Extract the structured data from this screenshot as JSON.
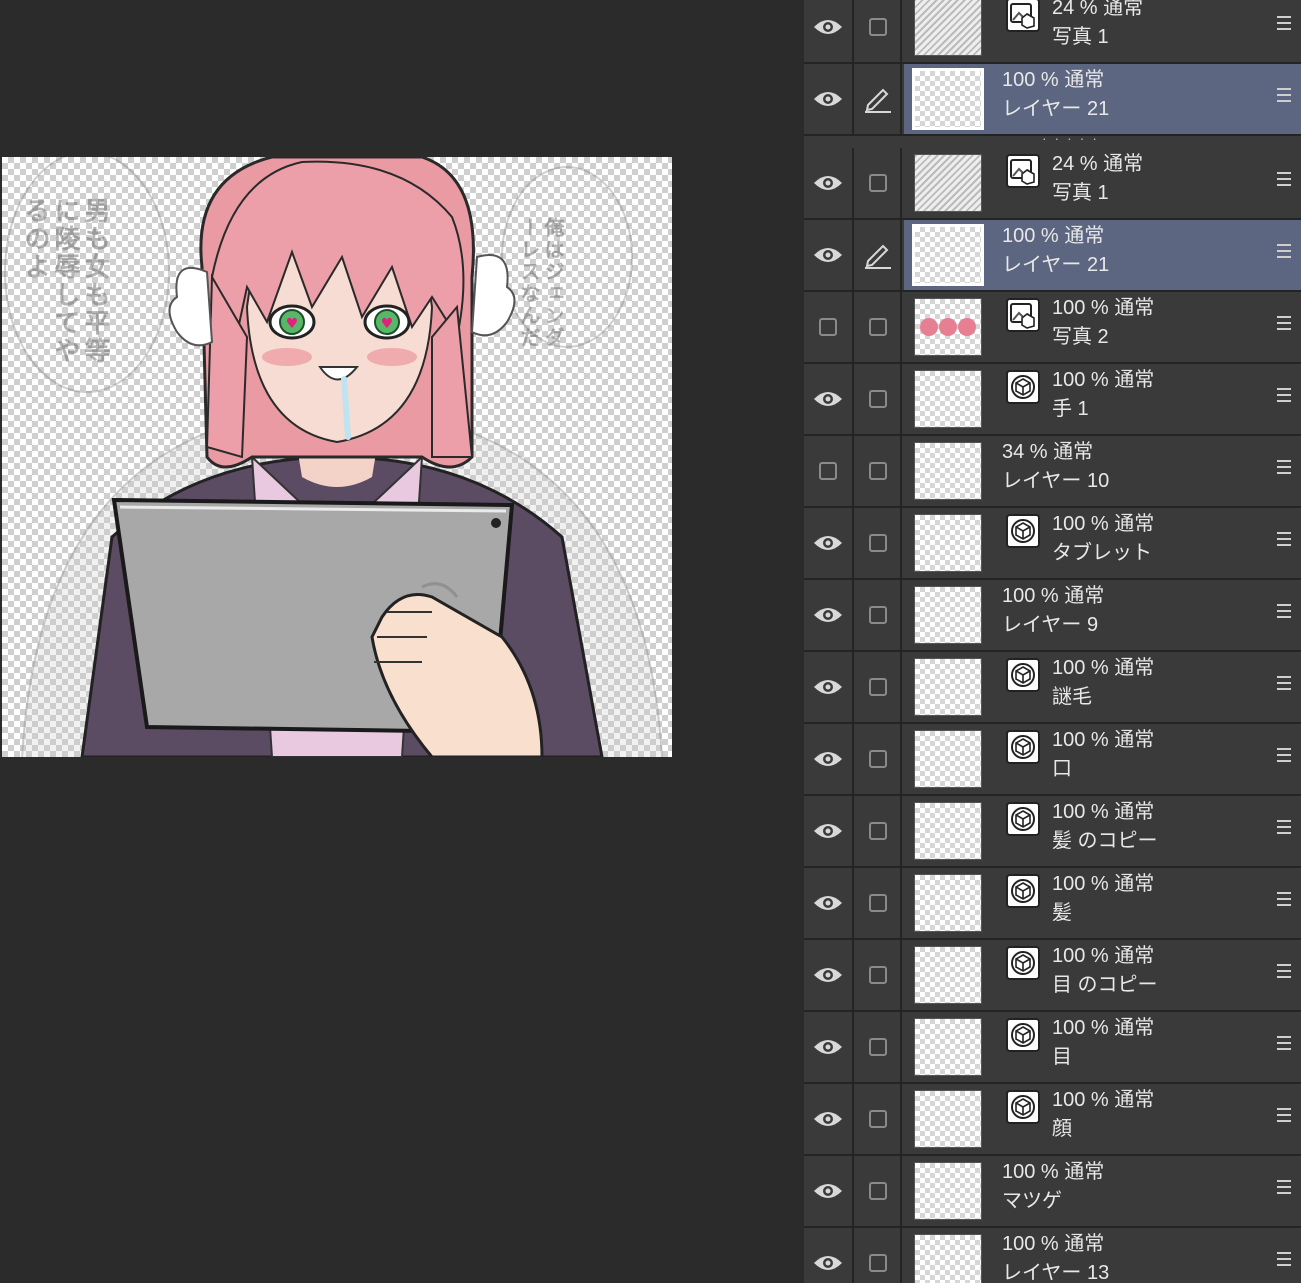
{
  "canvas": {
    "speech_left": "男も女も平等に陵辱してやるのよ",
    "speech_right": "俺はジェンダーレスなんだ"
  },
  "layers": [
    {
      "opacity_mode": "24 % 通常",
      "name": "写真 1",
      "visible": true,
      "selected": false,
      "editing": false,
      "badge": "image-3d-icon",
      "thumb": "photo"
    },
    {
      "opacity_mode": "100 % 通常",
      "name": "レイヤー 21",
      "visible": true,
      "selected": true,
      "editing": true,
      "badge": "",
      "thumb": "blank"
    },
    {
      "opacity_mode": "24 % 通常",
      "name": "写真 1",
      "visible": true,
      "selected": false,
      "editing": false,
      "badge": "image-3d-icon",
      "thumb": "photo"
    },
    {
      "opacity_mode": "100 % 通常",
      "name": "レイヤー 21",
      "visible": true,
      "selected": true,
      "editing": true,
      "badge": "",
      "thumb": "blank"
    },
    {
      "opacity_mode": "100 % 通常",
      "name": "写真 2",
      "visible": false,
      "selected": false,
      "editing": false,
      "badge": "image-3d-icon",
      "thumb": "faces"
    },
    {
      "opacity_mode": "100 % 通常",
      "name": "手 1",
      "visible": true,
      "selected": false,
      "editing": false,
      "badge": "cube-icon",
      "thumb": "blank"
    },
    {
      "opacity_mode": "34 % 通常",
      "name": "レイヤー 10",
      "visible": false,
      "selected": false,
      "editing": false,
      "badge": "",
      "thumb": "blank"
    },
    {
      "opacity_mode": "100 % 通常",
      "name": "タブレット",
      "visible": true,
      "selected": false,
      "editing": false,
      "badge": "cube-icon",
      "thumb": "blank"
    },
    {
      "opacity_mode": "100 % 通常",
      "name": "レイヤー 9",
      "visible": true,
      "selected": false,
      "editing": false,
      "badge": "",
      "thumb": "blank"
    },
    {
      "opacity_mode": "100 % 通常",
      "name": "謎毛",
      "visible": true,
      "selected": false,
      "editing": false,
      "badge": "cube-icon",
      "thumb": "blank"
    },
    {
      "opacity_mode": "100 % 通常",
      "name": "口",
      "visible": true,
      "selected": false,
      "editing": false,
      "badge": "cube-icon",
      "thumb": "blank"
    },
    {
      "opacity_mode": "100 % 通常",
      "name": "髪 のコピー",
      "visible": true,
      "selected": false,
      "editing": false,
      "badge": "cube-icon",
      "thumb": "blank"
    },
    {
      "opacity_mode": "100 % 通常",
      "name": "髪",
      "visible": true,
      "selected": false,
      "editing": false,
      "badge": "cube-icon",
      "thumb": "blank"
    },
    {
      "opacity_mode": "100 % 通常",
      "name": "目 のコピー",
      "visible": true,
      "selected": false,
      "editing": false,
      "badge": "cube-icon",
      "thumb": "blank"
    },
    {
      "opacity_mode": "100 % 通常",
      "name": "目",
      "visible": true,
      "selected": false,
      "editing": false,
      "badge": "cube-icon",
      "thumb": "blank"
    },
    {
      "opacity_mode": "100 % 通常",
      "name": "顔",
      "visible": true,
      "selected": false,
      "editing": false,
      "badge": "cube-icon",
      "thumb": "blank"
    },
    {
      "opacity_mode": "100 % 通常",
      "name": "マツゲ",
      "visible": true,
      "selected": false,
      "editing": false,
      "badge": "",
      "thumb": "blank"
    },
    {
      "opacity_mode": "100 % 通常",
      "name": "レイヤー 13",
      "visible": true,
      "selected": false,
      "editing": false,
      "badge": "",
      "thumb": "blank"
    }
  ]
}
